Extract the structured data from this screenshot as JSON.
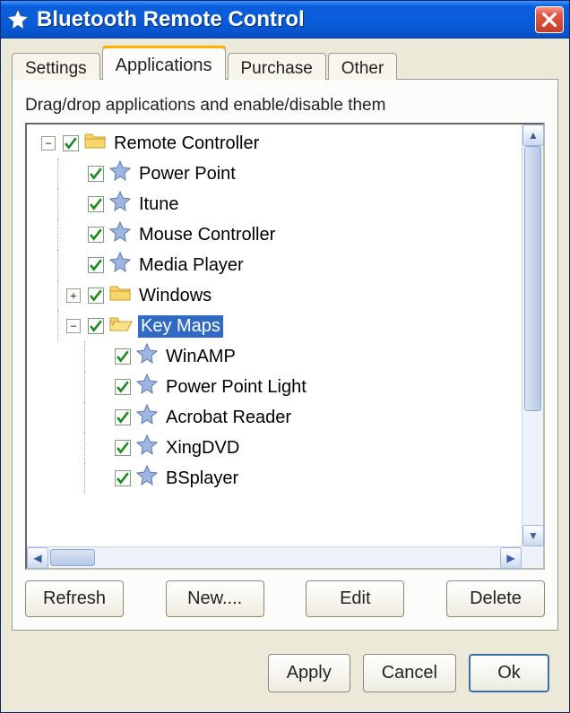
{
  "window": {
    "title": "Bluetooth Remote Control"
  },
  "tabs": {
    "settings": "Settings",
    "applications": "Applications",
    "purchase": "Purchase",
    "other": "Other",
    "active": "applications"
  },
  "panel": {
    "instructions": "Drag/drop applications and enable/disable them"
  },
  "tree": {
    "root": {
      "label": "Remote Controller",
      "checked": true,
      "expanded": true,
      "icon": "folder"
    },
    "children": [
      {
        "label": "Power Point",
        "checked": true,
        "icon": "star"
      },
      {
        "label": "Itune",
        "checked": true,
        "icon": "star"
      },
      {
        "label": "Mouse Controller",
        "checked": true,
        "icon": "star"
      },
      {
        "label": "Media Player",
        "checked": true,
        "icon": "star"
      },
      {
        "label": "Windows",
        "checked": true,
        "icon": "folder",
        "expanded": false
      },
      {
        "label": "Key Maps",
        "checked": true,
        "icon": "folder",
        "expanded": true,
        "selected": true,
        "children": [
          {
            "label": "WinAMP",
            "checked": true,
            "icon": "star"
          },
          {
            "label": "Power Point Light",
            "checked": true,
            "icon": "star"
          },
          {
            "label": "Acrobat Reader",
            "checked": true,
            "icon": "star"
          },
          {
            "label": "XingDVD",
            "checked": true,
            "icon": "star"
          },
          {
            "label": "BSplayer",
            "checked": true,
            "icon": "star"
          }
        ]
      }
    ]
  },
  "buttons": {
    "refresh": "Refresh",
    "new": "New....",
    "edit": "Edit",
    "delete": "Delete"
  },
  "footer": {
    "apply": "Apply",
    "cancel": "Cancel",
    "ok": "Ok"
  }
}
